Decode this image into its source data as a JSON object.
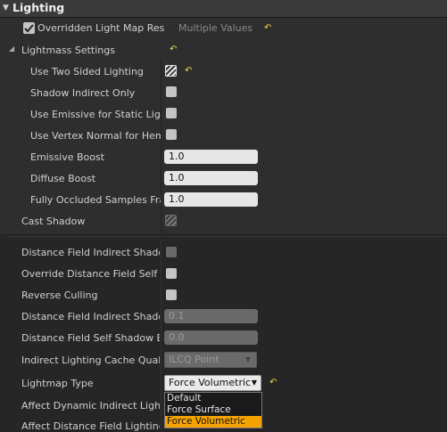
{
  "header": {
    "title": "Lighting",
    "collapse_glyph": "▼"
  },
  "overridden_row": {
    "label": "Overridden Light Map Res",
    "value": "Multiple Values",
    "checked": true
  },
  "lightmass": {
    "group_label": "Lightmass Settings",
    "group_glyph": "◢",
    "items": [
      {
        "label": "Use Two Sided Lighting"
      },
      {
        "label": "Shadow Indirect Only"
      },
      {
        "label": "Use Emissive for Static Lighting"
      },
      {
        "label": "Use Vertex Normal for Hemisphere Gather"
      },
      {
        "label": "Emissive Boost",
        "value": "1.0"
      },
      {
        "label": "Diffuse Boost",
        "value": "1.0"
      },
      {
        "label": "Fully Occluded Samples Fraction",
        "value": "1.0"
      }
    ]
  },
  "cast_shadow": {
    "label": "Cast Shadow"
  },
  "advanced": {
    "items": [
      {
        "label": "Distance Field Indirect Shadow"
      },
      {
        "label": "Override Distance Field Self Shadow Bias"
      },
      {
        "label": "Reverse Culling"
      },
      {
        "label": "Distance Field Indirect Shadow Min Visibility",
        "value": "0.1"
      },
      {
        "label": "Distance Field Self Shadow Bias",
        "value": "0.0"
      },
      {
        "label": "Indirect Lighting Cache Quality",
        "value": "ILCQ Point"
      },
      {
        "label": "Lightmap Type",
        "value": "Force Volumetric"
      },
      {
        "label": "Affect Dynamic Indirect Lighting"
      },
      {
        "label": "Affect Distance Field Lighting"
      }
    ]
  },
  "lightmap_dropdown": {
    "options": [
      "Default",
      "Force Surface",
      "Force Volumetric"
    ],
    "selected": "Force Volumetric"
  },
  "reset_icon": "↶",
  "colors": {
    "accent": "#f5a300",
    "reset": "#e8d84a",
    "panel": "#2e2e2e"
  }
}
